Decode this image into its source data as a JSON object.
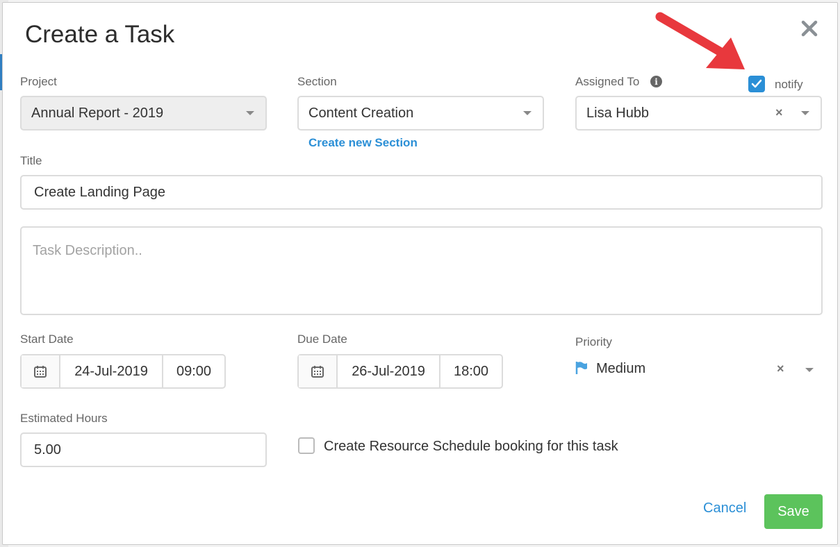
{
  "dialog": {
    "title": "Create a Task"
  },
  "project": {
    "label": "Project",
    "value": "Annual Report - 2019"
  },
  "section": {
    "label": "Section",
    "value": "Content Creation",
    "create_link": "Create new Section"
  },
  "assigned_to": {
    "label": "Assigned To",
    "value": "Lisa Hubb",
    "notify_label": "notify",
    "notify_checked": true
  },
  "title_field": {
    "label": "Title",
    "value": "Create Landing Page"
  },
  "description": {
    "placeholder": "Task Description.."
  },
  "start_date": {
    "label": "Start Date",
    "date": "24-Jul-2019",
    "time": "09:00"
  },
  "due_date": {
    "label": "Due Date",
    "date": "26-Jul-2019",
    "time": "18:00"
  },
  "priority": {
    "label": "Priority",
    "value": "Medium",
    "flag_color": "#4aa3e0"
  },
  "estimated_hours": {
    "label": "Estimated Hours",
    "value": "5.00"
  },
  "resource_booking": {
    "label": "Create Resource Schedule booking for this task",
    "checked": false
  },
  "actions": {
    "cancel": "Cancel",
    "save": "Save"
  },
  "colors": {
    "accent": "#2b8fd6",
    "save": "#5cc35c",
    "annotation_arrow": "#e8383d"
  }
}
